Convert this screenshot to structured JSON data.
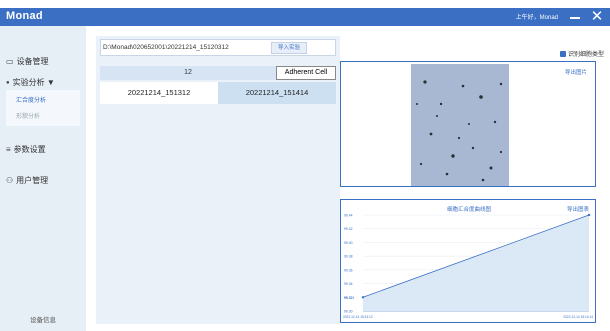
{
  "app": {
    "title": "Monad",
    "greeting": "上午好，Monad"
  },
  "sidebar": {
    "items": [
      {
        "label": "设备管理",
        "icon": "monitor-icon"
      },
      {
        "label": "实验分析 ▼",
        "icon": "dot-icon"
      },
      {
        "label": "参数设置",
        "icon": "sliders-icon"
      },
      {
        "label": "用户管理",
        "icon": "users-icon"
      }
    ],
    "sub_items": [
      "汇合度分析",
      "形貌分析"
    ],
    "footer": "设备信息"
  },
  "left": {
    "path": "D:\\Monad\\020652001\\20221214_15120312",
    "import_label": "导入实验",
    "count": "12",
    "cell_type": "Adherent Cell",
    "experiments": [
      "20221214_151312",
      "20221214_151414"
    ]
  },
  "right": {
    "checkbox_label": "识别细胞类型",
    "export_image_label": "导出图片",
    "export_chart_label": "导出图表"
  },
  "chart_data": {
    "type": "area",
    "title": "细胞汇合度曲线图",
    "y_ticks": [
      "99.44",
      "99.42",
      "99.40",
      "99.38",
      "99.36",
      "99.34",
      "99.32",
      "99.30"
    ],
    "x_labels": [
      "2022-12-14 15:13:12",
      "2022-12-14 15:14:14"
    ],
    "x": [
      "2022-12-14 15:13:12",
      "2022-12-14 15:14:14"
    ],
    "y": [
      99.32,
      99.44
    ],
    "start_label": "99.321",
    "ylim": [
      99.3,
      99.44
    ],
    "colors": {
      "line": "#3a6fc4",
      "fill": "#dbe9f7"
    }
  },
  "colors": {
    "accent": "#3a6fc4",
    "sidebar": "#e6eef6"
  }
}
